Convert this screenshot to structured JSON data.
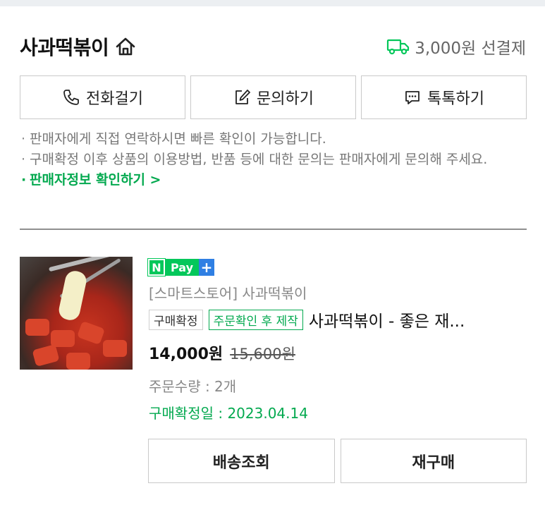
{
  "store": {
    "name": "사과떡볶이",
    "home_icon": "home-icon",
    "shipping_icon": "truck-icon",
    "shipping_text": "3,000원 선결제",
    "accent_color": "#03c75a"
  },
  "contact": {
    "call_label": "전화걸기",
    "inquiry_label": "문의하기",
    "talk_label": "톡톡하기"
  },
  "notes": {
    "line1": "판매자에게 직접 연락하시면 빠른 확인이 가능합니다.",
    "line2": "구매확정 이후 상품의 이용방법, 반품 등에 대한 문의는 판매자에게 문의해 주세요.",
    "link": "판매자정보 확인하기 >"
  },
  "order": {
    "pay_n": "N",
    "pay_label": "Pay",
    "pay_plus": "+",
    "store_line": "[스마트스토어] 사과떡볶이",
    "badge_confirmed": "구매확정",
    "badge_made": "주문확인 후 제작",
    "product_name": "사과떡볶이 - 좋은 재...",
    "price": "14,000원",
    "original_price": "15,600원",
    "quantity": "주문수량 : 2개",
    "confirm_date": "구매확정일 : 2023.04.14",
    "track_label": "배송조회",
    "rebuy_label": "재구매"
  }
}
